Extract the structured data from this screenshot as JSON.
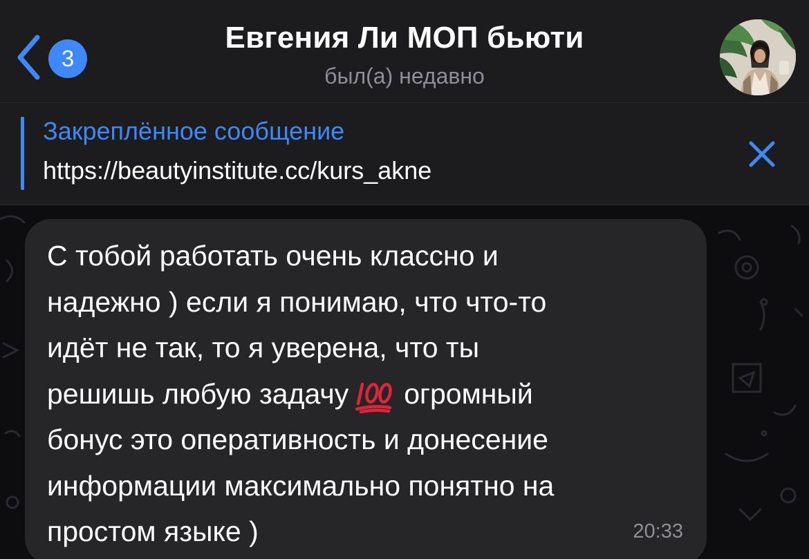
{
  "header": {
    "back_badge_count": "3",
    "title": "Евгения Ли МОП бьюти",
    "status": "был(а) недавно"
  },
  "pinned": {
    "title": "Закреплённое сообщение",
    "text": "https://beautyinstitute.cc/kurs_akne"
  },
  "message": {
    "lines": [
      "С тобой работать очень классно и",
      "надежно ) если я понимаю, что что-то",
      "идёт не так, то я уверена, что ты",
      "решишь любую задачу",
      "огромный",
      "бонус это оперативность и донесение",
      "информации максимально понятно на",
      "простом языке )"
    ],
    "emoji": "hundred-points-icon",
    "time": "20:33"
  },
  "colors": {
    "accent": "#3e88f7",
    "header_bg": "#1c1c1e",
    "bubble_bg": "#262628",
    "secondary_text": "#8e8e93"
  }
}
